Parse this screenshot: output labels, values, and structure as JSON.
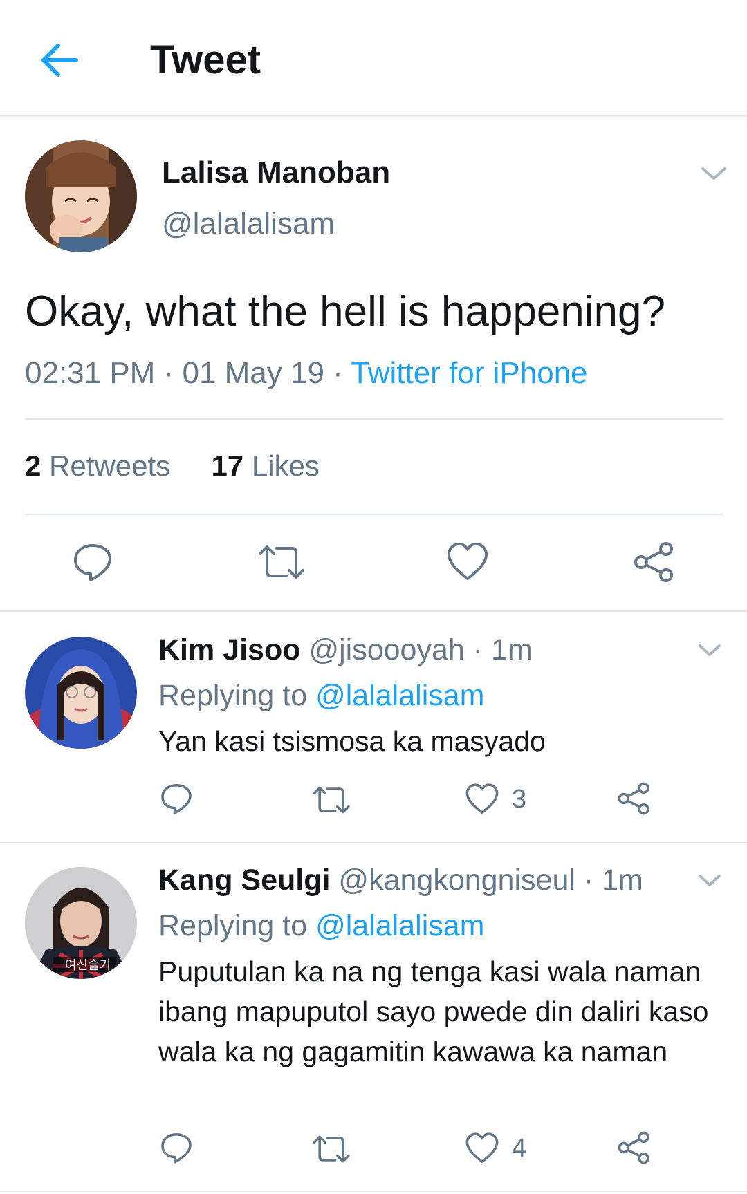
{
  "header": {
    "title": "Tweet"
  },
  "main_tweet": {
    "name": "Lalisa Manoban",
    "handle": "@lalalalisam",
    "text": "Okay, what the hell is happening?",
    "time": "02:31 PM",
    "date": "01 May 19",
    "sep": "·",
    "source": "Twitter for iPhone",
    "retweets_count": "2",
    "retweets_label": "Retweets",
    "likes_count": "17",
    "likes_label": "Likes"
  },
  "replies": [
    {
      "name": "Kim Jisoo",
      "handle": "@jisoooyah",
      "age": "· 1m",
      "replying_label": "Replying to",
      "replying_to": "@lalalalisam",
      "text": "Yan kasi tsismosa ka masyado",
      "likes": "3"
    },
    {
      "name": "Kang Seulgi",
      "handle": "@kangkongniseul",
      "age": "· 1m",
      "replying_label": "Replying to",
      "replying_to": "@lalalalisam",
      "text": "Puputulan ka na ng tenga kasi wala naman ibang mapuputol sayo pwede din daliri kaso wala ka ng gagamitin kawawa ka naman",
      "likes": "4",
      "avatar_text": "여신슬기"
    }
  ],
  "colors": {
    "accent": "#1da1f2",
    "secondary": "#657786",
    "text": "#14171a",
    "divider": "#e1e8ed"
  },
  "icons": [
    "back-arrow-icon",
    "chevron-down-icon",
    "reply-icon",
    "retweet-icon",
    "heart-icon",
    "share-icon"
  ]
}
